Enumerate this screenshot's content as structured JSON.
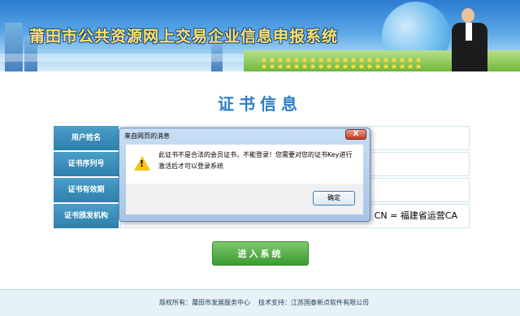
{
  "banner": {
    "title": "莆田市公共资源网上交易企业信息申报系统"
  },
  "page": {
    "heading": "证书信息"
  },
  "form": {
    "rows": [
      {
        "label": "用户姓名",
        "value": ""
      },
      {
        "label": "证书序列号",
        "value": ""
      },
      {
        "label": "证书有效期",
        "value": ""
      },
      {
        "label": "证书颁发机构",
        "value": "公司 CN = 福建省运营CA"
      }
    ]
  },
  "enter_button": {
    "label": "进入系统"
  },
  "footer": {
    "copyright": "版权所有：莆田市发展服务中心",
    "support": "技术支持：江苏国泰新点软件有限公司"
  },
  "dialog": {
    "title": "来自网页的消息",
    "message": "此证书不是合法的会员证书，不能登录！您需要对您的证书Key进行激活后才可以登录系统",
    "ok_label": "确定",
    "close_label": "X"
  }
}
